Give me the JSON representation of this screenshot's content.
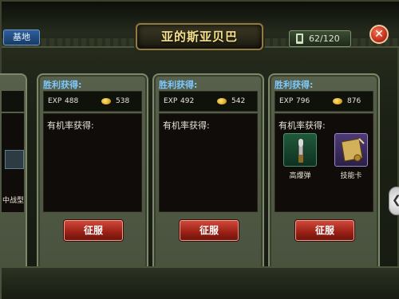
{
  "header": {
    "base_tab": "基地",
    "title": "亚的斯亚贝巴",
    "stamina": "62/120",
    "close_symbol": "✕"
  },
  "cards": [
    {
      "victory_label": "胜利获得:",
      "exp_label": "EXP",
      "exp_value": "488",
      "gold_value": "538",
      "drops_label": "有机率获得:",
      "conquer_label": "征服"
    },
    {
      "victory_label": "胜利获得:",
      "exp_label": "EXP",
      "exp_value": "492",
      "gold_value": "542",
      "drops_label": "有机率获得:",
      "conquer_label": "征服"
    },
    {
      "victory_label": "胜利获得:",
      "exp_label": "EXP",
      "exp_value": "796",
      "gold_value": "876",
      "drops_label": "有机率获得:",
      "conquer_label": "征服",
      "items": [
        {
          "label": "高爆弹",
          "icon": "shell-icon"
        },
        {
          "label": "技能卡",
          "icon": "skill-card-icon"
        }
      ]
    }
  ],
  "left_partial": {
    "label": "中战型"
  },
  "icons": {
    "coin": "gold-coin-icon",
    "right_arrow": "chevron-right-icon",
    "stamina": "stamina-icon"
  },
  "colors": {
    "victory_label": "#7ec8ff",
    "title_text": "#f6e08a",
    "conquer_button": "#c9392b"
  }
}
